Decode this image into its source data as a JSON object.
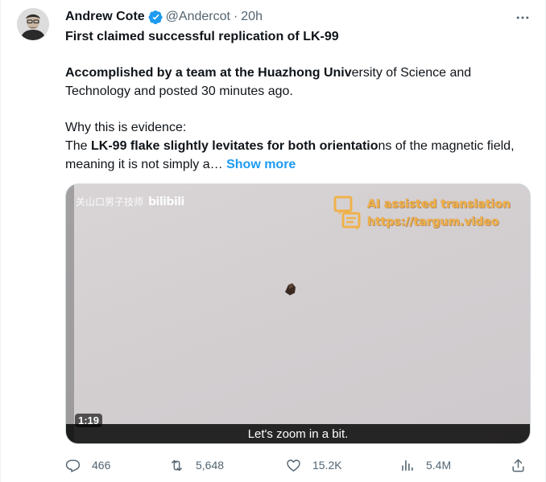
{
  "author": {
    "name": "Andrew Cote",
    "handle": "@Andercot",
    "separator": "·",
    "time": "20h"
  },
  "tweet": {
    "line1": "First claimed successful replication of LK-99",
    "para2_bold": "Accomplished by a team at the Huazhong Univ",
    "para2_rest": "ersity of Science and Technology and posted 30 minutes ago.",
    "para3_line1": "Why this is evidence:",
    "para3_pre": "The ",
    "para3_bold": "LK-99 flake slightly levitates for both orientatio",
    "para3_rest": "ns of the magnetic field, meaning it is not simply a…",
    "show_more": "Show more"
  },
  "media": {
    "watermark": "关山口男子技师",
    "watermark_logo": "bilibili",
    "overlay_line1": "AI assisted translation",
    "overlay_line2": "https://targum.video",
    "duration": "1:19",
    "caption": "Let's zoom in a bit."
  },
  "actions": {
    "replies": "466",
    "retweets": "5,648",
    "likes": "15.2K",
    "views": "5.4M"
  },
  "colors": {
    "accent": "#1d9bf0",
    "secondary_text": "#536471",
    "overlay_orange": "#f0b14a"
  }
}
